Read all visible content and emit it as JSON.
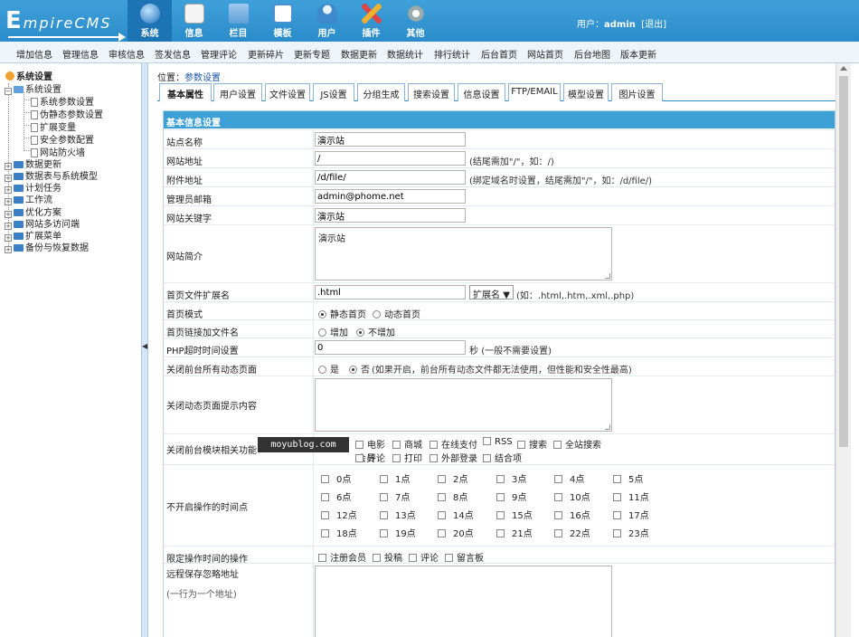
{
  "header": {
    "logo_prefix": "E",
    "logo_text": "mpireCMS",
    "tabs": [
      {
        "label": "系统",
        "icon": "globe-icon"
      },
      {
        "label": "信息",
        "icon": "edit-icon"
      },
      {
        "label": "栏目",
        "icon": "folder-icon"
      },
      {
        "label": "模板",
        "icon": "window-icon"
      },
      {
        "label": "用户",
        "icon": "user-icon"
      },
      {
        "label": "插件",
        "icon": "tools-icon"
      },
      {
        "label": "其他",
        "icon": "gear-icon"
      }
    ],
    "user_label": "用户：",
    "username": "admin",
    "logout": "[退出]"
  },
  "menubar": [
    "增加信息",
    "管理信息",
    "审核信息",
    "签发信息",
    "管理评论",
    "更新碎片",
    "更新专题",
    "数据更新",
    "数据统计",
    "排行统计",
    "后台首页",
    "网站首页",
    "后台地图",
    "版本更新"
  ],
  "tree": {
    "root": "系统设置",
    "open_folder": "系统设置",
    "children": [
      "系统参数设置",
      "伪静态参数设置",
      "扩展变量",
      "安全参数配置",
      "网站防火墙"
    ],
    "folders": [
      "数据更新",
      "数据表与系统模型",
      "计划任务",
      "工作流",
      "优化方案",
      "网站多访问端",
      "扩展菜单",
      "备份与恢复数据"
    ]
  },
  "location": {
    "label": "位置：",
    "link": "参数设置"
  },
  "tabs": [
    "基本属性",
    "用户设置",
    "文件设置",
    "JS设置",
    "分组生成",
    "搜索设置",
    "信息设置",
    "FTP/EMAIL",
    "模型设置",
    "图片设置"
  ],
  "section_title": "基本信息设置",
  "fields": {
    "site_name": {
      "label": "站点名称",
      "value": "演示站"
    },
    "site_url": {
      "label": "网站地址",
      "value": "/",
      "hint": "(结尾需加\"/\"，如：/)"
    },
    "attach_url": {
      "label": "附件地址",
      "value": "/d/file/",
      "hint": "(绑定域名时设置，结尾需加\"/\"，如：/d/file/)"
    },
    "admin_email": {
      "label": "管理员邮箱",
      "value": "admin@phome.net"
    },
    "keywords": {
      "label": "网站关键字",
      "value": "演示站"
    },
    "description": {
      "label": "网站简介",
      "value": "演示站"
    },
    "index_ext": {
      "label": "首页文件扩展名",
      "value": ".html",
      "select": "扩展名",
      "hint": "(如：.html,.htm,.xml,.php)"
    },
    "index_mode": {
      "label": "首页模式",
      "opt1": "静态首页",
      "opt2": "动态首页"
    },
    "index_link": {
      "label": "首页链接加文件名",
      "opt1": "增加",
      "opt2": "不增加"
    },
    "php_timeout": {
      "label": "PHP超时时间设置",
      "value": "0",
      "unit": "秒",
      "hint": "(一般不需要设置)"
    },
    "close_dynamic": {
      "label": "关闭前台所有动态页面",
      "opt1": "是",
      "opt2": "否",
      "hint": "(如果开启，前台所有动态文件都无法使用，但性能和安全性最高)"
    },
    "close_tip": {
      "label": "关闭动态页面提示内容"
    },
    "close_modules": {
      "label": "关闭前台模块相关功能",
      "row1": [
        "",
        "电影",
        "商城",
        "在线支付",
        "RSS",
        "搜索",
        "全站搜索"
      ],
      "row2": [
        "会员",
        "评论",
        "打印",
        "外部登录",
        "结合项"
      ]
    },
    "no_op_hours": {
      "label": "不开启操作的时间点",
      "hours": [
        "0点",
        "1点",
        "2点",
        "3点",
        "4点",
        "5点",
        "6点",
        "7点",
        "8点",
        "9点",
        "10点",
        "11点",
        "12点",
        "13点",
        "14点",
        "15点",
        "16点",
        "17点",
        "18点",
        "19点",
        "20点",
        "21点",
        "22点",
        "23点"
      ]
    },
    "limit_ops": {
      "label": "限定操作时间的操作",
      "opts": [
        "注册会员",
        "投稿",
        "评论",
        "留言板"
      ]
    },
    "remote_ignore": {
      "label": "远程保存忽略地址",
      "sub": "(一行为一个地址)"
    }
  },
  "watermark": "moyublog.com"
}
